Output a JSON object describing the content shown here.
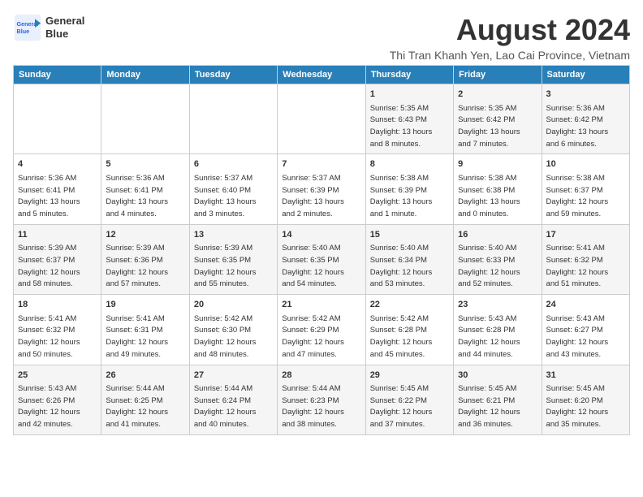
{
  "logo": {
    "line1": "General",
    "line2": "Blue"
  },
  "title": "August 2024",
  "subtitle": "Thi Tran Khanh Yen, Lao Cai Province, Vietnam",
  "days_of_week": [
    "Sunday",
    "Monday",
    "Tuesday",
    "Wednesday",
    "Thursday",
    "Friday",
    "Saturday"
  ],
  "weeks": [
    [
      {
        "day": "",
        "content": ""
      },
      {
        "day": "",
        "content": ""
      },
      {
        "day": "",
        "content": ""
      },
      {
        "day": "",
        "content": ""
      },
      {
        "day": "1",
        "content": "Sunrise: 5:35 AM\nSunset: 6:43 PM\nDaylight: 13 hours\nand 8 minutes."
      },
      {
        "day": "2",
        "content": "Sunrise: 5:35 AM\nSunset: 6:42 PM\nDaylight: 13 hours\nand 7 minutes."
      },
      {
        "day": "3",
        "content": "Sunrise: 5:36 AM\nSunset: 6:42 PM\nDaylight: 13 hours\nand 6 minutes."
      }
    ],
    [
      {
        "day": "4",
        "content": "Sunrise: 5:36 AM\nSunset: 6:41 PM\nDaylight: 13 hours\nand 5 minutes."
      },
      {
        "day": "5",
        "content": "Sunrise: 5:36 AM\nSunset: 6:41 PM\nDaylight: 13 hours\nand 4 minutes."
      },
      {
        "day": "6",
        "content": "Sunrise: 5:37 AM\nSunset: 6:40 PM\nDaylight: 13 hours\nand 3 minutes."
      },
      {
        "day": "7",
        "content": "Sunrise: 5:37 AM\nSunset: 6:39 PM\nDaylight: 13 hours\nand 2 minutes."
      },
      {
        "day": "8",
        "content": "Sunrise: 5:38 AM\nSunset: 6:39 PM\nDaylight: 13 hours\nand 1 minute."
      },
      {
        "day": "9",
        "content": "Sunrise: 5:38 AM\nSunset: 6:38 PM\nDaylight: 13 hours\nand 0 minutes."
      },
      {
        "day": "10",
        "content": "Sunrise: 5:38 AM\nSunset: 6:37 PM\nDaylight: 12 hours\nand 59 minutes."
      }
    ],
    [
      {
        "day": "11",
        "content": "Sunrise: 5:39 AM\nSunset: 6:37 PM\nDaylight: 12 hours\nand 58 minutes."
      },
      {
        "day": "12",
        "content": "Sunrise: 5:39 AM\nSunset: 6:36 PM\nDaylight: 12 hours\nand 57 minutes."
      },
      {
        "day": "13",
        "content": "Sunrise: 5:39 AM\nSunset: 6:35 PM\nDaylight: 12 hours\nand 55 minutes."
      },
      {
        "day": "14",
        "content": "Sunrise: 5:40 AM\nSunset: 6:35 PM\nDaylight: 12 hours\nand 54 minutes."
      },
      {
        "day": "15",
        "content": "Sunrise: 5:40 AM\nSunset: 6:34 PM\nDaylight: 12 hours\nand 53 minutes."
      },
      {
        "day": "16",
        "content": "Sunrise: 5:40 AM\nSunset: 6:33 PM\nDaylight: 12 hours\nand 52 minutes."
      },
      {
        "day": "17",
        "content": "Sunrise: 5:41 AM\nSunset: 6:32 PM\nDaylight: 12 hours\nand 51 minutes."
      }
    ],
    [
      {
        "day": "18",
        "content": "Sunrise: 5:41 AM\nSunset: 6:32 PM\nDaylight: 12 hours\nand 50 minutes."
      },
      {
        "day": "19",
        "content": "Sunrise: 5:41 AM\nSunset: 6:31 PM\nDaylight: 12 hours\nand 49 minutes."
      },
      {
        "day": "20",
        "content": "Sunrise: 5:42 AM\nSunset: 6:30 PM\nDaylight: 12 hours\nand 48 minutes."
      },
      {
        "day": "21",
        "content": "Sunrise: 5:42 AM\nSunset: 6:29 PM\nDaylight: 12 hours\nand 47 minutes."
      },
      {
        "day": "22",
        "content": "Sunrise: 5:42 AM\nSunset: 6:28 PM\nDaylight: 12 hours\nand 45 minutes."
      },
      {
        "day": "23",
        "content": "Sunrise: 5:43 AM\nSunset: 6:28 PM\nDaylight: 12 hours\nand 44 minutes."
      },
      {
        "day": "24",
        "content": "Sunrise: 5:43 AM\nSunset: 6:27 PM\nDaylight: 12 hours\nand 43 minutes."
      }
    ],
    [
      {
        "day": "25",
        "content": "Sunrise: 5:43 AM\nSunset: 6:26 PM\nDaylight: 12 hours\nand 42 minutes."
      },
      {
        "day": "26",
        "content": "Sunrise: 5:44 AM\nSunset: 6:25 PM\nDaylight: 12 hours\nand 41 minutes."
      },
      {
        "day": "27",
        "content": "Sunrise: 5:44 AM\nSunset: 6:24 PM\nDaylight: 12 hours\nand 40 minutes."
      },
      {
        "day": "28",
        "content": "Sunrise: 5:44 AM\nSunset: 6:23 PM\nDaylight: 12 hours\nand 38 minutes."
      },
      {
        "day": "29",
        "content": "Sunrise: 5:45 AM\nSunset: 6:22 PM\nDaylight: 12 hours\nand 37 minutes."
      },
      {
        "day": "30",
        "content": "Sunrise: 5:45 AM\nSunset: 6:21 PM\nDaylight: 12 hours\nand 36 minutes."
      },
      {
        "day": "31",
        "content": "Sunrise: 5:45 AM\nSunset: 6:20 PM\nDaylight: 12 hours\nand 35 minutes."
      }
    ]
  ]
}
